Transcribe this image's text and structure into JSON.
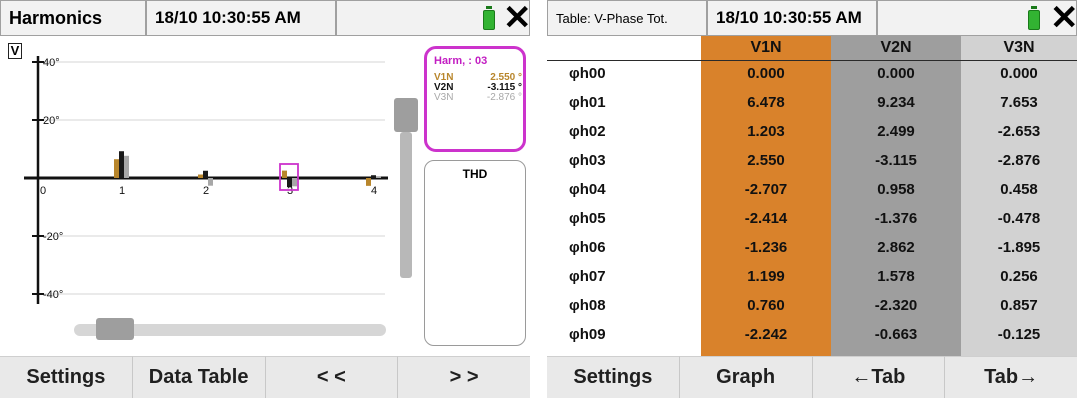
{
  "left": {
    "header": {
      "title": "Harmonics",
      "timestamp": "18/10 10:30:55 AM"
    },
    "unit_box": "V",
    "chart_data": {
      "type": "bar",
      "categories": [
        "0",
        "1",
        "2",
        "3",
        "4"
      ],
      "series": [
        {
          "name": "V1N",
          "color": "#b8862c",
          "values": [
            0,
            6.478,
            1.203,
            2.55,
            -2.707
          ]
        },
        {
          "name": "V2N",
          "color": "#1a1a1a",
          "values": [
            0,
            9.234,
            2.499,
            -3.115,
            0.958
          ]
        },
        {
          "name": "V3N",
          "color": "#a8a8a8",
          "values": [
            0,
            7.653,
            -2.653,
            -2.876,
            0.458
          ]
        }
      ],
      "y_ticks": [
        "40°",
        "20°",
        "-20°",
        "-40°"
      ],
      "ylim": [
        -45,
        45
      ],
      "selected_category": "3",
      "grid": true
    },
    "harm_panel": {
      "title": "Harm, : 03",
      "rows": [
        {
          "label": "V1N",
          "value": "2.550 °",
          "color": "#b8862c"
        },
        {
          "label": "V2N",
          "value": "-3.115 °",
          "color": "#111111"
        },
        {
          "label": "V3N",
          "value": "-2.876 °",
          "color": "#a8a8a8"
        }
      ]
    },
    "thd_label": "THD",
    "footer": [
      "Settings",
      "Data Table",
      "< <",
      "> >"
    ]
  },
  "right": {
    "header": {
      "title": "Table: V-Phase Tot.",
      "timestamp": "18/10 10:30:55 AM"
    },
    "columns": [
      "V1N",
      "V2N",
      "V3N"
    ],
    "column_colors": [
      "#d9822b",
      "#9e9e9e",
      "#d2d2d2"
    ],
    "rows": [
      {
        "label": "φh00",
        "values": [
          "0.000",
          "0.000",
          "0.000"
        ]
      },
      {
        "label": "φh01",
        "values": [
          "6.478",
          "9.234",
          "7.653"
        ]
      },
      {
        "label": "φh02",
        "values": [
          "1.203",
          "2.499",
          "-2.653"
        ]
      },
      {
        "label": "φh03",
        "values": [
          "2.550",
          "-3.115",
          "-2.876"
        ]
      },
      {
        "label": "φh04",
        "values": [
          "-2.707",
          "0.958",
          "0.458"
        ]
      },
      {
        "label": "φh05",
        "values": [
          "-2.414",
          "-1.376",
          "-0.478"
        ]
      },
      {
        "label": "φh06",
        "values": [
          "-1.236",
          "2.862",
          "-1.895"
        ]
      },
      {
        "label": "φh07",
        "values": [
          "1.199",
          "1.578",
          "0.256"
        ]
      },
      {
        "label": "φh08",
        "values": [
          "0.760",
          "-2.320",
          "0.857"
        ]
      },
      {
        "label": "φh09",
        "values": [
          "-2.242",
          "-0.663",
          "-0.125"
        ]
      }
    ],
    "footer": [
      "Settings",
      "Graph",
      "←Tab",
      "Tab→"
    ]
  }
}
